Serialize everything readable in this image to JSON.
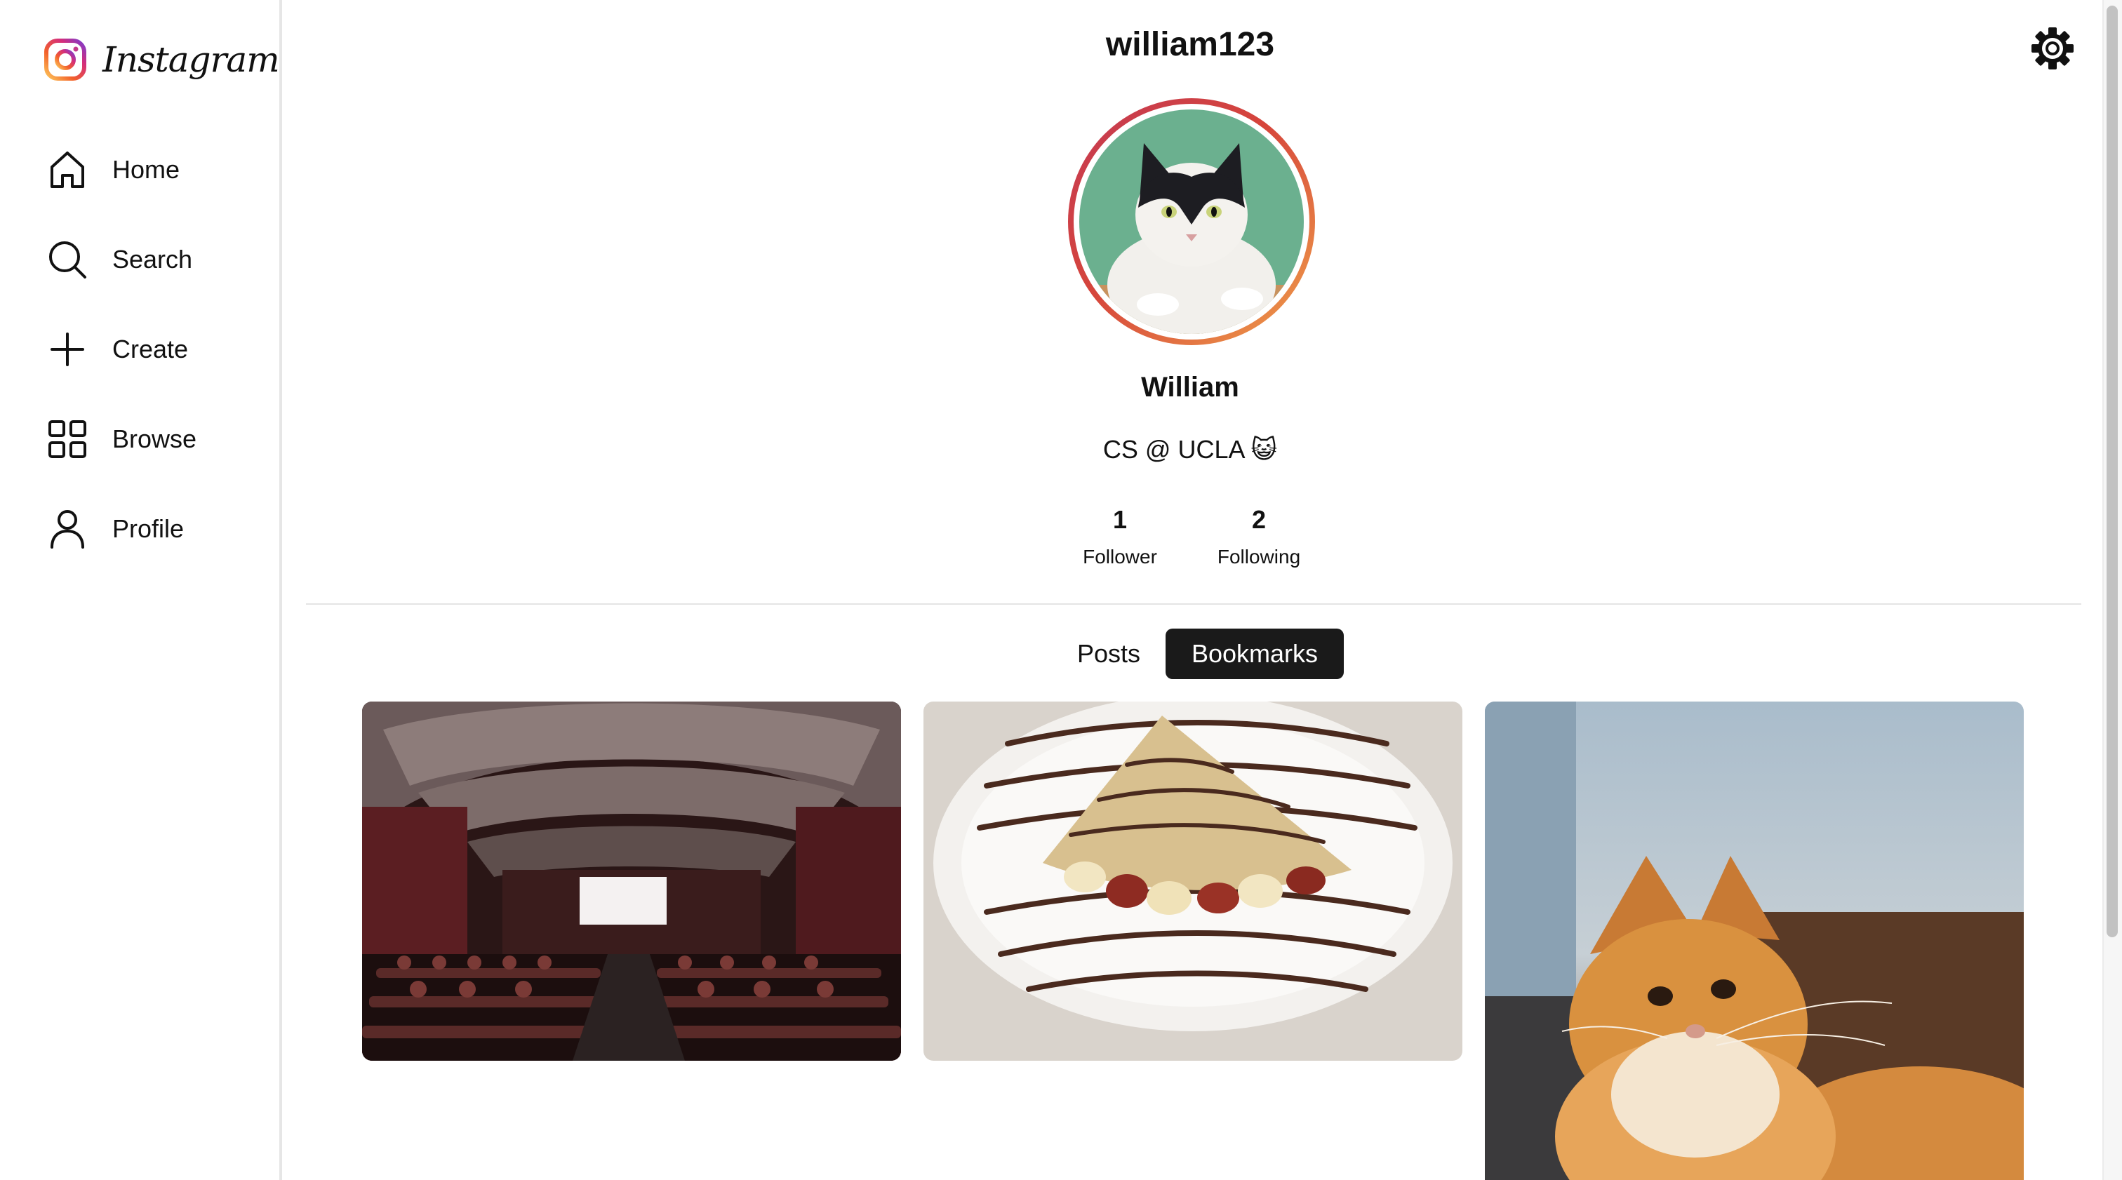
{
  "app": {
    "brand": "Instagram",
    "brand_icon": "instagram-logo-icon"
  },
  "sidebar": {
    "items": [
      {
        "label": "Home",
        "icon": "home-icon"
      },
      {
        "label": "Search",
        "icon": "search-icon"
      },
      {
        "label": "Create",
        "icon": "plus-icon"
      },
      {
        "label": "Browse",
        "icon": "grid-icon"
      },
      {
        "label": "Profile",
        "icon": "user-icon"
      }
    ]
  },
  "profile": {
    "username": "william123",
    "display_name": "William",
    "bio": "CS @ UCLA 😺",
    "avatar_icon": "cat-avatar",
    "stats": [
      {
        "count": "1",
        "label": "Follower"
      },
      {
        "count": "2",
        "label": "Following"
      }
    ],
    "settings_icon": "gear-icon"
  },
  "tabs": [
    {
      "label": "Posts",
      "active": false
    },
    {
      "label": "Bookmarks",
      "active": true
    }
  ],
  "bookmarks": [
    {
      "subject": "movie theater"
    },
    {
      "subject": "crepe with chocolate drizzle"
    },
    {
      "subject": "orange tabby cat"
    }
  ],
  "colors": {
    "accent_dark": "#1a1a1a",
    "ring_start": "#f0a14a",
    "ring_end": "#c43a54"
  }
}
